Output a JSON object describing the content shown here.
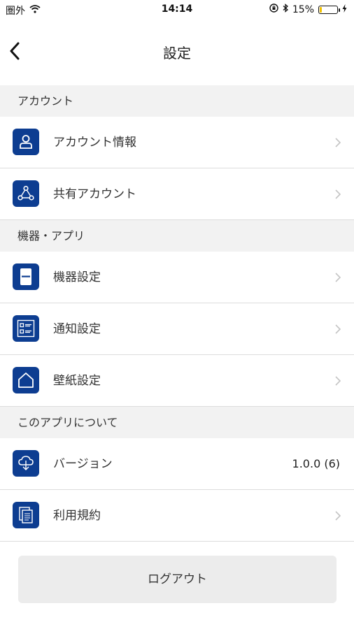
{
  "status_bar": {
    "carrier": "圏外",
    "time": "14:14",
    "battery_percent": "15%",
    "battery_level": 0.15
  },
  "nav": {
    "title": "設定"
  },
  "sections": {
    "account": {
      "header": "アカウント",
      "items": [
        {
          "label": "アカウント情報",
          "icon": "person-icon"
        },
        {
          "label": "共有アカウント",
          "icon": "shared-account-icon"
        }
      ]
    },
    "devices": {
      "header": "機器・アプリ",
      "items": [
        {
          "label": "機器設定",
          "icon": "device-icon"
        },
        {
          "label": "通知設定",
          "icon": "notification-list-icon"
        },
        {
          "label": "壁紙設定",
          "icon": "home-icon"
        }
      ]
    },
    "about": {
      "header": "このアプリについて",
      "items": [
        {
          "label": "バージョン",
          "icon": "cloud-icon",
          "value": "1.0.0 (6)"
        },
        {
          "label": "利用規約",
          "icon": "document-icon"
        }
      ]
    }
  },
  "logout": {
    "label": "ログアウト"
  }
}
